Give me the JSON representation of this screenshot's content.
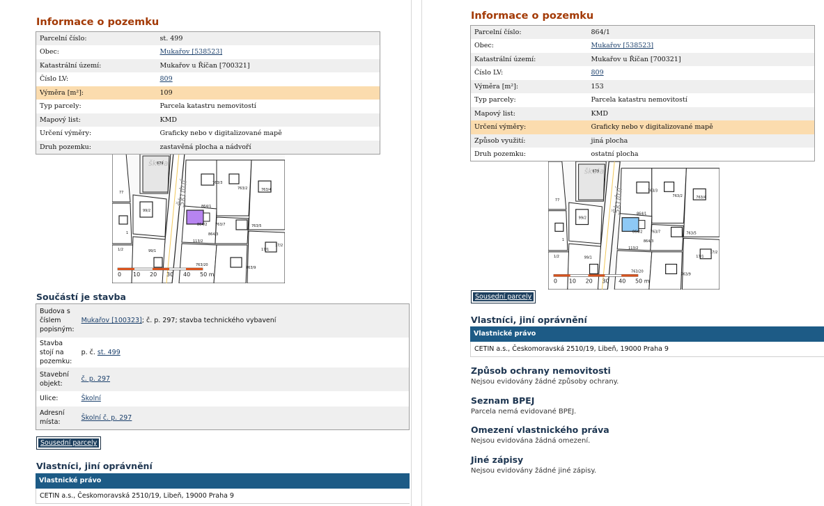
{
  "left": {
    "title": "Informace o pozemku",
    "info": [
      {
        "label": "Parcelní číslo:",
        "value": "st. 499",
        "link": false
      },
      {
        "label": "Obec:",
        "value": "Mukařov [538523]",
        "link": true
      },
      {
        "label": "Katastrální území:",
        "value": "Mukařov u Říčan [700321]",
        "link": false
      },
      {
        "label": "Číslo LV:",
        "value": "809",
        "link": true
      },
      {
        "label": "Výměra [m²]:",
        "value": "109",
        "link": false
      },
      {
        "label": "Typ parcely:",
        "value": "Parcela katastru nemovitostí",
        "link": false
      },
      {
        "label": "Mapový list:",
        "value": "KMD",
        "link": false
      },
      {
        "label": "Určení výměry:",
        "value": "Graficky nebo v digitalizované mapě",
        "link": false
      },
      {
        "label": "Druh pozemku:",
        "value": "zastavěná plocha a nádvoří",
        "link": false
      }
    ],
    "map": {
      "street_label": "Školní",
      "area_label": "škola",
      "scale": [
        "0",
        "10",
        "20",
        "30",
        "40",
        "50 m"
      ],
      "parcel_labels": [
        "679",
        "864/1",
        "864/2",
        "763/2",
        "763/3",
        "763/4",
        "763/7",
        "763/5",
        "763/20",
        "113/2",
        "864/3",
        "99/2",
        "1/2",
        "17/1",
        "17/2",
        "77",
        "763/9",
        "99/1",
        "1"
      ],
      "highlight_color": "#b784f0"
    },
    "stavba": {
      "title": "Součástí je stavba",
      "rows": [
        {
          "label": "Budova s číslem popisným:",
          "link": "Mukařov [100323]",
          "rest": "; č. p. 297; stavba technického vybavení",
          "prefix": ""
        },
        {
          "label": "Stavba stojí na pozemku:",
          "prefix": "p. č. ",
          "link": "st. 499",
          "rest": ""
        },
        {
          "label": "Stavební objekt:",
          "prefix": "",
          "link": "č. p. 297",
          "rest": ""
        },
        {
          "label": "Ulice:",
          "prefix": "",
          "link": "Školní",
          "rest": ""
        },
        {
          "label": "Adresní místa:",
          "prefix": "",
          "link": "Školní č. p. 297",
          "rest": ""
        }
      ]
    },
    "sousedni": "Sousední parcely",
    "owners_title": "Vlastníci, jiní oprávnění",
    "owners_head": "Vlastnické právo",
    "owners_row": "CETIN a.s., Českomoravská 2510/19, Libeň, 19000 Praha 9"
  },
  "right": {
    "title": "Informace o pozemku",
    "info": [
      {
        "label": "Parcelní číslo:",
        "value": "864/1",
        "link": false
      },
      {
        "label": "Obec:",
        "value": "Mukařov [538523]",
        "link": true
      },
      {
        "label": "Katastrální území:",
        "value": "Mukařov u Říčan [700321]",
        "link": false
      },
      {
        "label": "Číslo LV:",
        "value": "809",
        "link": true
      },
      {
        "label": "Výměra [m²]:",
        "value": "153",
        "link": false
      },
      {
        "label": "Typ parcely:",
        "value": "Parcela katastru nemovitostí",
        "link": false
      },
      {
        "label": "Mapový list:",
        "value": "KMD",
        "link": false
      },
      {
        "label": "Určení výměry:",
        "value": "Graficky nebo v digitalizované mapě",
        "link": false
      },
      {
        "label": "Způsob využití:",
        "value": "jiná plocha",
        "link": false
      },
      {
        "label": "Druh pozemku:",
        "value": "ostatní plocha",
        "link": false
      }
    ],
    "map": {
      "street_label": "Školní",
      "area_label": "škola",
      "scale": [
        "0",
        "10",
        "20",
        "30",
        "40",
        "50 m"
      ],
      "parcel_labels": [
        "679",
        "864/1",
        "864/2",
        "763/2",
        "763/3",
        "763/4",
        "763/7",
        "763/5",
        "763/20",
        "113/2",
        "864/3",
        "99/2",
        "1/2",
        "17/1",
        "17/2",
        "77",
        "763/9",
        "99/1",
        "1"
      ],
      "highlight_color": "#8ec9f5"
    },
    "sousedni": "Sousední parcely",
    "owners_title": "Vlastníci, jiní oprávnění",
    "owners_head": "Vlastnické právo",
    "owners_row": "CETIN a.s., Českomoravská 2510/19, Libeň, 19000 Praha 9",
    "sections": [
      {
        "title": "Způsob ochrany nemovitosti",
        "text": "Nejsou evidovány žádné způsoby ochrany."
      },
      {
        "title": "Seznam BPEJ",
        "text": "Parcela nemá evidované BPEJ."
      },
      {
        "title": "Omezení vlastnického práva",
        "text": "Nejsou evidována žádná omezení."
      },
      {
        "title": "Jiné zápisy",
        "text": "Nejsou evidovány žádné jiné zápisy."
      }
    ]
  }
}
